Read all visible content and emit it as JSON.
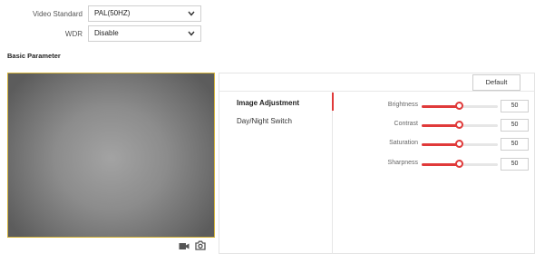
{
  "form": {
    "video_standard": {
      "label": "Video Standard",
      "value": "PAL(50HZ)"
    },
    "wdr": {
      "label": "WDR",
      "value": "Disable"
    }
  },
  "section_title": "Basic Parameter",
  "preview": {
    "toolbar_icons": [
      "video-camera-icon",
      "camera-icon"
    ]
  },
  "panel": {
    "default_button": "Default",
    "tabs": [
      {
        "label": "Image Adjustment",
        "active": true
      },
      {
        "label": "Day/Night Switch",
        "active": false
      }
    ],
    "parameters": [
      {
        "label": "Brightness",
        "value": "50",
        "level": 50
      },
      {
        "label": "Contrast",
        "value": "50",
        "level": 50
      },
      {
        "label": "Saturation",
        "value": "50",
        "level": 50
      },
      {
        "label": "Sharpness",
        "value": "50",
        "level": 50
      }
    ]
  },
  "colors": {
    "accent": "#e03a3a",
    "video_border": "#d4b43c"
  }
}
